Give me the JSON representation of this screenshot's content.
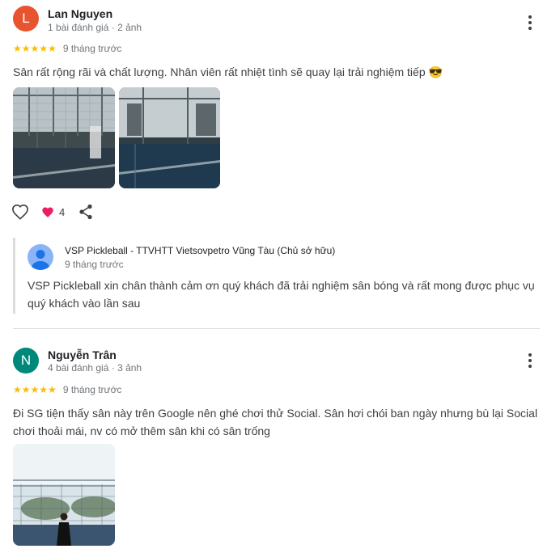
{
  "reviews": [
    {
      "initial": "L",
      "avatar_color": "#e8542f",
      "name": "Lan Nguyen",
      "meta": "1 bài đánh giá · 2 ảnh",
      "rating": 5,
      "time_ago": "9 tháng trước",
      "text": "Sân rất rộng rãi và chất lượng. Nhân viên rất nhiệt tình sẽ quay lại trải nghiệm tiếp 😎",
      "likes": "4",
      "reply": {
        "owner": "VSP Pickleball - TTVHTT Vietsovpetro Vũng Tàu (Chủ sở hữu)",
        "time_ago": "9 tháng trước",
        "text_line1": "VSP Pickleball xin chân thành cảm ơn quý khách đã trải nghiệm sân bóng và rất mong được phục vụ",
        "text_line2": "quý khách vào lần sau"
      }
    },
    {
      "initial": "N",
      "avatar_color": "#00897b",
      "name": "Nguyễn Trân",
      "meta": "4 bài đánh giá · 3 ảnh",
      "rating": 5,
      "time_ago": "9 tháng trước",
      "text_line1": "Đi SG tiện thấy sân này trên Google nên ghé chơi thử Social. Sân hơi chói ban ngày nhưng bù lại Social",
      "text_line2": "chơi thoải mái, nv có mở thêm sân khi có sân trống"
    }
  ],
  "icons": {
    "more": "more-vert-icon",
    "like": "heart-outline-icon",
    "liked": "heart-filled-icon",
    "share": "share-icon",
    "owner_avatar": "person-avatar-icon"
  },
  "colors": {
    "star": "#fbbc04",
    "heart": "#e91e63",
    "owner_avatar": "#8ab4f8"
  }
}
